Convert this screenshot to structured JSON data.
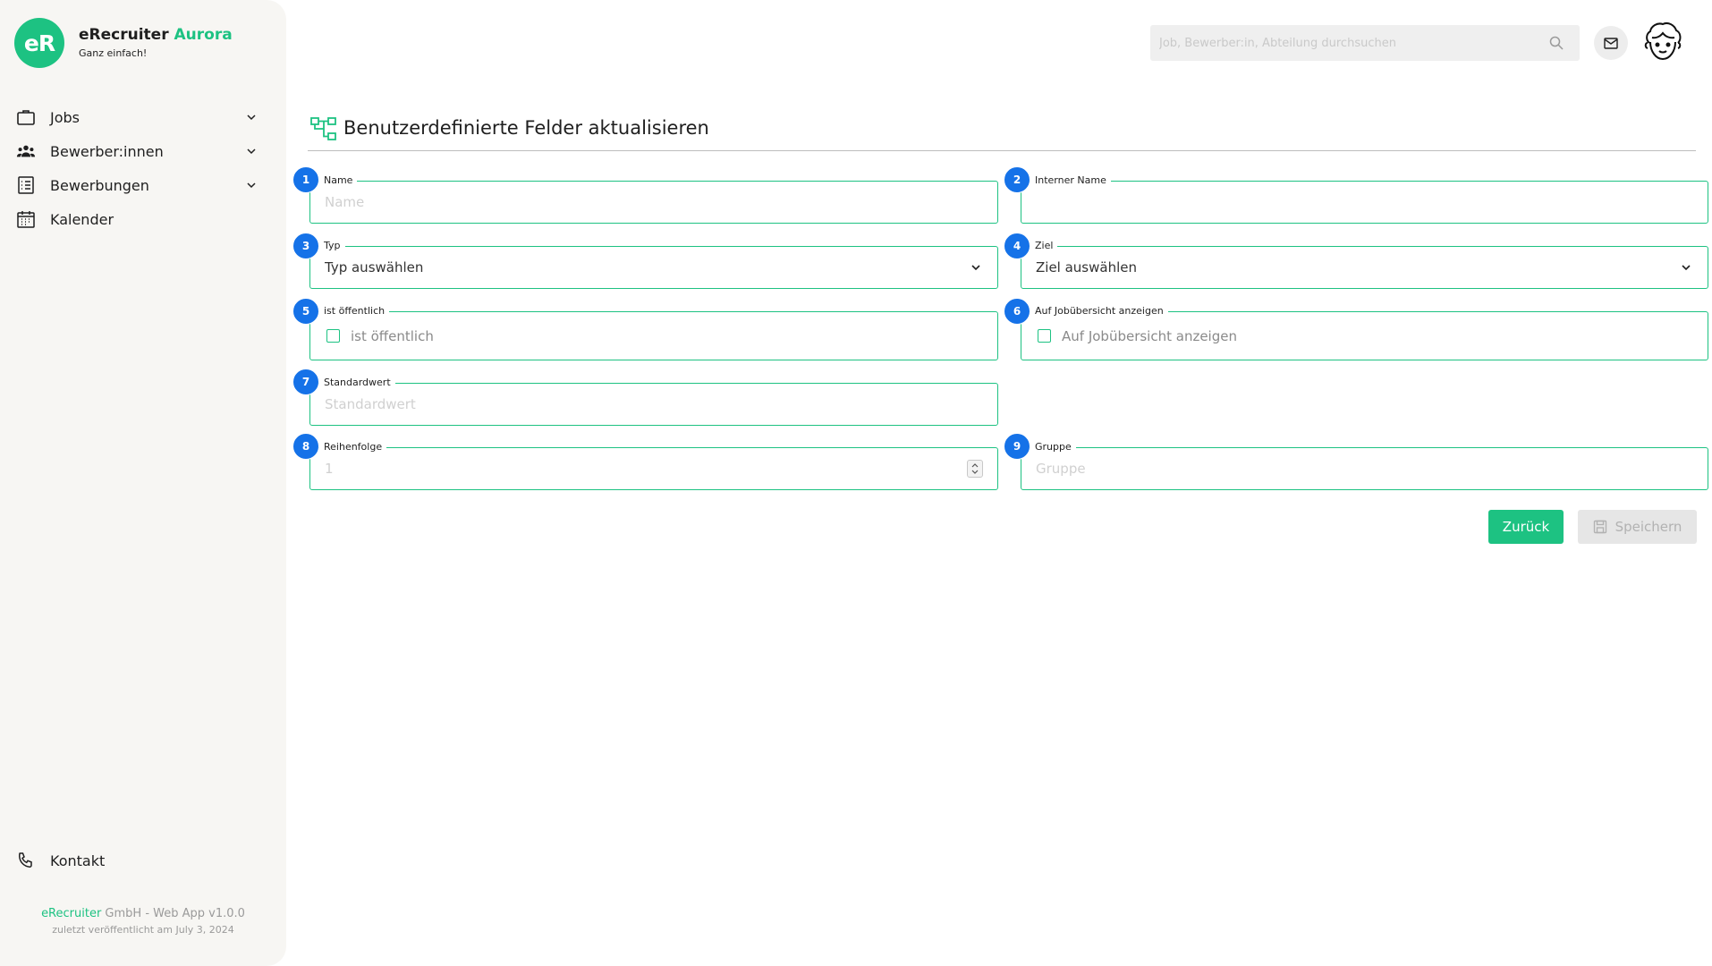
{
  "brand": {
    "logo_text": "eR",
    "name": "eRecruiter",
    "name_accent": "Aurora",
    "tagline": "Ganz einfach!"
  },
  "sidebar": {
    "items": [
      {
        "label": "Jobs",
        "icon": "briefcase-icon",
        "has_chevron": true
      },
      {
        "label": "Bewerber:innen",
        "icon": "people-icon",
        "has_chevron": true
      },
      {
        "label": "Bewerbungen",
        "icon": "list-document-icon",
        "has_chevron": true
      },
      {
        "label": "Kalender",
        "icon": "calendar-icon",
        "has_chevron": false
      }
    ],
    "contact_label": "Kontakt",
    "footer_company": "eRecruiter",
    "footer_suffix": " GmbH - Web App v1.0.0",
    "footer_published": "zuletzt veröffentlicht am July 3, 2024"
  },
  "header": {
    "search_placeholder": "Job, Bewerber:in, Abteilung durchsuchen"
  },
  "page": {
    "title": "Benutzerdefinierte Felder aktualisieren"
  },
  "form": {
    "fields": [
      {
        "badge": "1",
        "legend": "Name",
        "placeholder": "Name",
        "type": "text"
      },
      {
        "badge": "2",
        "legend": "Interner Name",
        "placeholder": "",
        "type": "text"
      },
      {
        "badge": "3",
        "legend": "Typ",
        "placeholder": "Typ auswählen",
        "type": "select"
      },
      {
        "badge": "4",
        "legend": "Ziel",
        "placeholder": "Ziel auswählen",
        "type": "select"
      },
      {
        "badge": "5",
        "legend": "ist öffentlich",
        "checkbox_label": "ist öffentlich",
        "type": "checkbox",
        "checked": false
      },
      {
        "badge": "6",
        "legend": "Auf Jobübersicht anzeigen",
        "checkbox_label": "Auf Jobübersicht anzeigen",
        "type": "checkbox",
        "checked": false
      },
      {
        "badge": "7",
        "legend": "Standardwert",
        "placeholder": "Standardwert",
        "type": "text"
      },
      {
        "badge": "8",
        "legend": "Reihenfolge",
        "placeholder": "1",
        "type": "number"
      },
      {
        "badge": "9",
        "legend": "Gruppe",
        "placeholder": "Gruppe",
        "type": "text"
      }
    ]
  },
  "actions": {
    "back_label": "Zurück",
    "save_label": "Speichern"
  },
  "colors": {
    "accent": "#1dc282",
    "badge": "#1572e8",
    "sidebar_bg": "#f7f6f3"
  }
}
